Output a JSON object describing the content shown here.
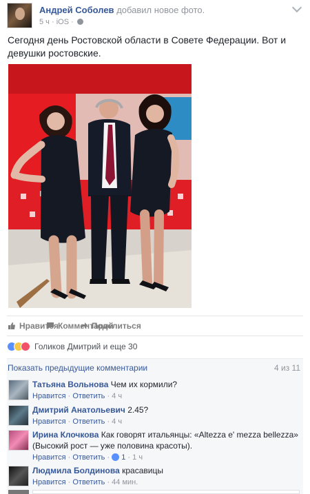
{
  "post": {
    "author": "Андрей Соболев",
    "action": "добавил новое фото.",
    "time": "5 ч",
    "sep": "·",
    "device": "iOS",
    "text": "Сегодня день Ростовской области в Совете Федерации. Вот и девушки ростовские."
  },
  "actions": {
    "like": "Нравится",
    "comment": "Комментарий",
    "share": "Поделиться"
  },
  "reactions": {
    "text": "Голиков Дмитрий и еще 30"
  },
  "comments_header": {
    "prev": "Показать предыдущие комментарии",
    "count": "4 из 11"
  },
  "comments": [
    {
      "name": "Татьяна Вольнова",
      "text": "Чем их кормили?",
      "like": "Нравится",
      "dot1": "·",
      "reply": "Ответить",
      "dot2": "·",
      "time": "4 ч"
    },
    {
      "name": "Дмитрий Анатольевич",
      "text": "2.45?",
      "like": "Нравится",
      "dot1": "·",
      "reply": "Ответить",
      "dot2": "·",
      "time": "4 ч"
    },
    {
      "name": "Ирина Клочкова",
      "text": "Как говорят итальянцы: «Altezza e' mezza bellezza» (Высокий рост — уже половина красоты).",
      "like": "Нравится",
      "dot1": "·",
      "reply": "Ответить",
      "dot2": "·",
      "likes": "1",
      "dot3": "·",
      "time": "1 ч"
    },
    {
      "name": "Людмила Болдинова",
      "text": "красавицы",
      "like": "Нравится",
      "dot1": "·",
      "reply": "Ответить",
      "dot2": "·",
      "time": "44 мин."
    }
  ],
  "colors": {
    "link": "#365899",
    "muted": "#90949c",
    "background_red": "#d51d22"
  },
  "icons": [
    "chevron-down-icon",
    "globe-icon",
    "like-icon",
    "comment-icon",
    "share-icon",
    "like-reaction-icon",
    "wow-reaction-icon",
    "love-reaction-icon"
  ]
}
